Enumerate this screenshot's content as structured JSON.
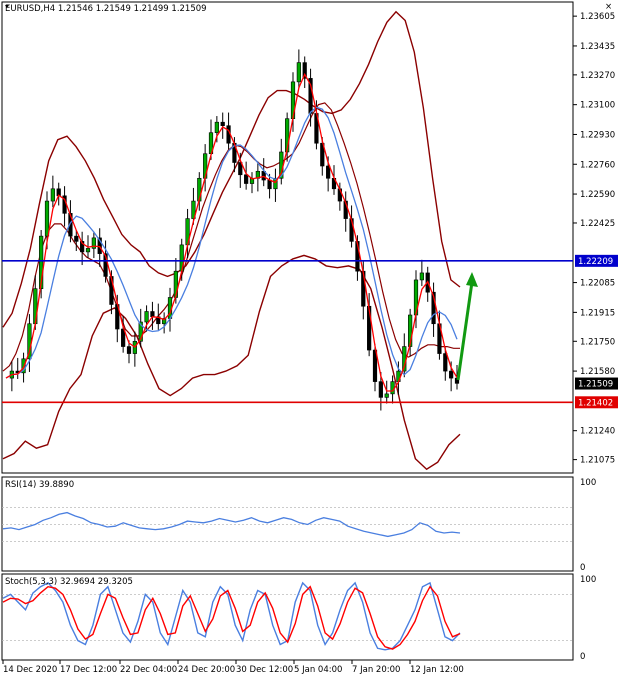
{
  "header": {
    "title": "EURUSD,H4  1.21546 1.21549 1.21499 1.21509",
    "rsi_label": "RSI(14) 39.8890",
    "stoch_label": "Stoch(5,3,3) 32.9694 29.3205"
  },
  "colors": {
    "candle_body": "#000000",
    "bull_candle": "#00aa00",
    "bollinger": "#8b0000",
    "ma_fast": "#ff0000",
    "ma_slow": "#4a7fe0",
    "resistance": "#0000cc",
    "support": "#e00000",
    "arrow": "#119911",
    "rsi_line": "#4a7fe0",
    "stoch_main": "#4a7fe0",
    "stoch_signal": "#ff0000",
    "tag_bg": "#000000"
  },
  "icons": {
    "collapse": "triangle-down-icon",
    "close": "close-icon"
  },
  "chart_data": {
    "type": "line",
    "symbol": "EURUSD",
    "timeframe": "H4",
    "ohlc_last": {
      "open": 1.21546,
      "high": 1.21549,
      "low": 1.21499,
      "close": 1.21509
    },
    "price_axis": {
      "ticks": [
        1.23605,
        1.23435,
        1.2327,
        1.231,
        1.2293,
        1.2276,
        1.2259,
        1.22425,
        1.22085,
        1.21915,
        1.2175,
        1.2158,
        1.2124,
        1.21075
      ],
      "tick_labels": [
        "1.23605",
        "1.23435",
        "1.23270",
        "1.23100",
        "1.22930",
        "1.22760",
        "1.22590",
        "1.22425",
        "1.22085",
        "1.21915",
        "1.21750",
        "1.21580",
        "1.21240",
        "1.21075"
      ],
      "range": [
        1.2101,
        1.2368
      ]
    },
    "time_labels": [
      "14 Dec 2020",
      "17 Dec 12:00",
      "22 Dec 04:00",
      "24 Dec 20:00",
      "30 Dec 12:00",
      "5 Jan 04:00",
      "7 Jan 20:00",
      "12 Jan 12:00"
    ],
    "levels": [
      {
        "name": "resistance",
        "value": 1.22209,
        "label": "1.22209"
      },
      {
        "name": "support",
        "value": 1.21402,
        "label": "1.21402"
      }
    ],
    "current_price": {
      "value": 1.21509,
      "label": "1.21509"
    },
    "close_path": [
      1.2154,
      1.2158,
      1.2157,
      1.2165,
      1.2185,
      1.2205,
      1.2235,
      1.2255,
      1.2262,
      1.2258,
      1.2248,
      1.2235,
      1.2232,
      1.2226,
      1.2228,
      1.2234,
      1.2225,
      1.2212,
      1.2196,
      1.2182,
      1.2172,
      1.2168,
      1.2175,
      1.2186,
      1.2192,
      1.2189,
      1.2185,
      1.2188,
      1.22,
      1.2215,
      1.223,
      1.2245,
      1.2255,
      1.2268,
      1.2282,
      1.2294,
      1.23,
      1.2298,
      1.2288,
      1.2277,
      1.227,
      1.2265,
      1.2268,
      1.2272,
      1.2267,
      1.2262,
      1.2268,
      1.2283,
      1.2302,
      1.2323,
      1.2334,
      1.2325,
      1.2305,
      1.2288,
      1.2275,
      1.2268,
      1.2262,
      1.2255,
      1.2245,
      1.2232,
      1.2215,
      1.2195,
      1.217,
      1.2152,
      1.2143,
      1.2145,
      1.2152,
      1.2158,
      1.2172,
      1.219,
      1.221,
      1.2214,
      1.2203,
      1.2185,
      1.2168,
      1.2158,
      1.2154,
      1.2151
    ],
    "series": [
      {
        "values": [
          1.2158,
          1.2161,
          1.2168,
          1.2178,
          1.2193,
          1.2212,
          1.2228,
          1.2238,
          1.2242,
          1.2242,
          1.2238,
          1.2232,
          1.2227,
          1.2223,
          1.2221,
          1.2219,
          1.2212,
          1.2202,
          1.2192,
          1.2182,
          1.2178,
          1.2178,
          1.218,
          1.2184,
          1.2189,
          1.2193,
          1.2198,
          1.2205,
          1.2215,
          1.2227,
          1.2239,
          1.2251,
          1.2261,
          1.227,
          1.2278,
          1.2284,
          1.2287,
          1.2286,
          1.2283,
          1.2279,
          1.2276,
          1.2274,
          1.2275,
          1.2277,
          1.2279,
          1.2282,
          1.2288,
          1.2296,
          1.2304,
          1.231,
          1.2311,
          1.2307,
          1.2298,
          1.2288,
          1.2277,
          1.2265,
          1.2251,
          1.2236,
          1.222,
          1.2203,
          1.2188,
          1.2176,
          1.2168,
          1.2166,
          1.2168,
          1.2171,
          1.2173,
          1.2173,
          1.2172,
          1.2172,
          1.2171,
          1.2171
        ]
      },
      {
        "values": [
          1.2183,
          1.2191,
          1.2208,
          1.2228,
          1.2254,
          1.2278,
          1.229,
          1.2292,
          1.2286,
          1.2278,
          1.2268,
          1.2256,
          1.2246,
          1.2236,
          1.223,
          1.2226,
          1.2218,
          1.2214,
          1.2212,
          1.2214,
          1.2218,
          1.2226,
          1.2236,
          1.2248,
          1.226,
          1.227,
          1.228,
          1.2292,
          1.2304,
          1.2314,
          1.2318,
          1.2318,
          1.2316,
          1.2313,
          1.2309,
          1.2306,
          1.2305,
          1.2307,
          1.2313,
          1.2322,
          1.2333,
          1.2346,
          1.2357,
          1.2363,
          1.2358,
          1.234,
          1.2308,
          1.2268,
          1.2232,
          1.221,
          1.2206
        ]
      },
      {
        "values": [
          1.2108,
          1.2111,
          1.2118,
          1.2114,
          1.2116,
          1.2135,
          1.2148,
          1.2156,
          1.2178,
          1.2191,
          1.2194,
          1.2188,
          1.2178,
          1.2162,
          1.2148,
          1.2144,
          1.2148,
          1.2154,
          1.2156,
          1.2156,
          1.2158,
          1.2161,
          1.2167,
          1.2192,
          1.2212,
          1.2218,
          1.2222,
          1.2224,
          1.2222,
          1.2218,
          1.2217,
          1.2218,
          1.2216,
          1.2205,
          1.2183,
          1.2158,
          1.213,
          1.2108,
          1.2102,
          1.2106,
          1.2116,
          1.2122
        ]
      }
    ],
    "rsi": {
      "title": "RSI(14)",
      "last": 39.889,
      "ylim": [
        0,
        100
      ],
      "axis_ticks": [
        100,
        0
      ],
      "values": [
        45,
        46,
        44,
        47,
        50,
        55,
        58,
        62,
        64,
        60,
        57,
        52,
        50,
        47,
        48,
        52,
        49,
        46,
        45,
        44,
        45,
        47,
        50,
        54,
        53,
        52,
        54,
        57,
        55,
        53,
        55,
        58,
        54,
        52,
        55,
        58,
        56,
        52,
        50,
        55,
        58,
        56,
        54,
        48,
        45,
        42,
        40,
        38,
        36,
        38,
        40,
        44,
        52,
        49,
        42,
        40,
        41,
        40
      ]
    },
    "stoch": {
      "title": "Stoch(5,3,3)",
      "main_last": 32.9694,
      "signal_last": 29.3205,
      "ylim": [
        0,
        100
      ],
      "axis_ticks": [
        100,
        0
      ],
      "main": [
        75,
        80,
        70,
        60,
        82,
        90,
        95,
        85,
        70,
        40,
        20,
        15,
        40,
        80,
        90,
        60,
        30,
        18,
        45,
        80,
        70,
        30,
        15,
        50,
        85,
        70,
        30,
        25,
        70,
        90,
        80,
        40,
        20,
        60,
        85,
        80,
        40,
        15,
        20,
        70,
        95,
        85,
        40,
        15,
        30,
        60,
        85,
        95,
        70,
        30,
        10,
        8,
        10,
        20,
        40,
        60,
        90,
        95,
        60,
        25,
        20,
        30
      ],
      "signal": [
        70,
        75,
        74,
        68,
        72,
        82,
        90,
        88,
        80,
        60,
        35,
        22,
        28,
        55,
        80,
        75,
        50,
        28,
        30,
        60,
        75,
        55,
        28,
        30,
        65,
        78,
        55,
        32,
        48,
        78,
        85,
        62,
        32,
        40,
        70,
        82,
        62,
        30,
        18,
        42,
        80,
        90,
        65,
        30,
        22,
        42,
        70,
        88,
        82,
        55,
        25,
        12,
        9,
        15,
        28,
        45,
        72,
        90,
        78,
        45,
        25,
        29
      ]
    }
  }
}
